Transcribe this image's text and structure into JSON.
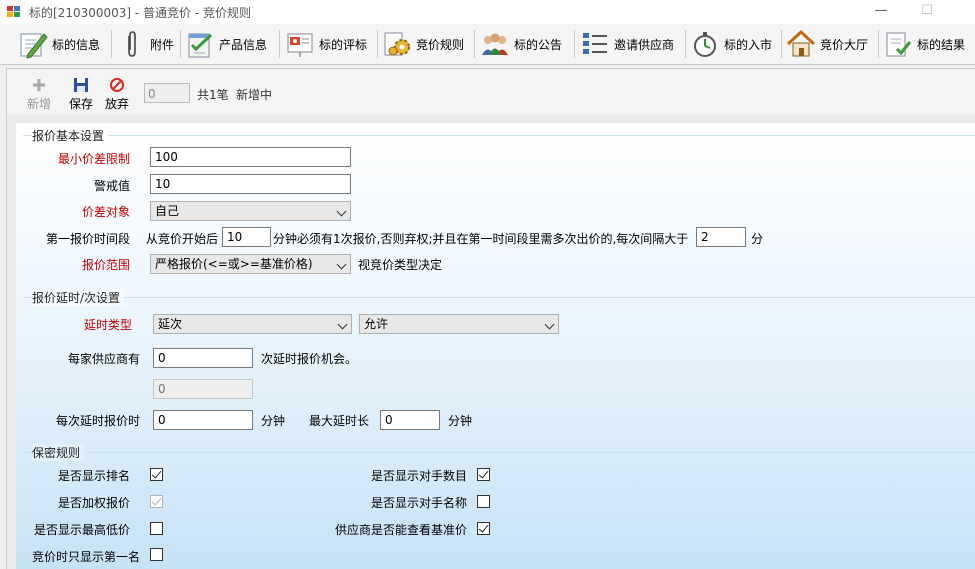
{
  "window": {
    "title": "标的[210300003] - 普通竞价 - 竞价规则",
    "minimize": "—",
    "maximize": "☐"
  },
  "toolbar": {
    "items": [
      {
        "label": "标的信息",
        "icon": "edit-pencil-icon"
      },
      {
        "label": "附件",
        "icon": "paperclip-icon"
      },
      {
        "label": "产品信息",
        "icon": "checklist-icon"
      },
      {
        "label": "标的评标",
        "icon": "presentation-icon"
      },
      {
        "label": "竞价规则",
        "icon": "gears-icon"
      },
      {
        "label": "标的公告",
        "icon": "people-icon"
      },
      {
        "label": "邀请供应商",
        "icon": "list-icon"
      },
      {
        "label": "标的入市",
        "icon": "stopwatch-icon"
      },
      {
        "label": "竞价大厅",
        "icon": "house-icon"
      },
      {
        "label": "标的结果",
        "icon": "result-doc-icon"
      }
    ]
  },
  "subbar": {
    "add": "新增",
    "save": "保存",
    "discard": "放弃",
    "counter": "0",
    "total": "共1笔",
    "status": "新增中"
  },
  "basic": {
    "title": "报价基本设置",
    "min_diff_label": "最小价差限制",
    "min_diff_value": "100",
    "warn_label": "警戒值",
    "warn_value": "10",
    "target_label": "价差对象",
    "target_value": "自己",
    "first_period_label": "第一报价时间段",
    "fp_text1": "从竞价开始后",
    "fp_value1": "10",
    "fp_text2": "分钟必须有1次报价,否则弃权;并且在第一时间段里需多次出价的,每次间隔大于",
    "fp_value2": "2",
    "fp_text3": "分",
    "range_label": "报价范围",
    "range_value": "严格报价(<=或>=基准价格)",
    "range_note": "视竞价类型决定"
  },
  "delay": {
    "title": "报价延时/次设置",
    "type_label": "延时类型",
    "type_value": "延次",
    "allow_value": "允许",
    "each_supplier_label": "每家供应商有",
    "each_supplier_value": "0",
    "each_supplier_suffix": "次延时报价机会。",
    "disabled_value": "0",
    "each_delay_label": "每次延时报价时",
    "each_delay_value": "0",
    "minutes1": "分钟",
    "max_delay_label": "最大延时长",
    "max_delay_value": "0",
    "minutes2": "分钟"
  },
  "secret": {
    "title": "保密规则",
    "show_rank": {
      "label": "是否显示排名",
      "checked": true
    },
    "weighted": {
      "label": "是否加权报价",
      "checked": true
    },
    "show_highlow": {
      "label": "是否显示最高低价",
      "checked": false
    },
    "show_first_only": {
      "label": "竞价时只显示第一名",
      "checked": false
    },
    "show_opp_count": {
      "label": "是否显示对手数目",
      "checked": true
    },
    "show_opp_name": {
      "label": "是否显示对手名称",
      "checked": false
    },
    "view_base": {
      "label": "供应商是否能查看基准价",
      "checked": true
    }
  }
}
